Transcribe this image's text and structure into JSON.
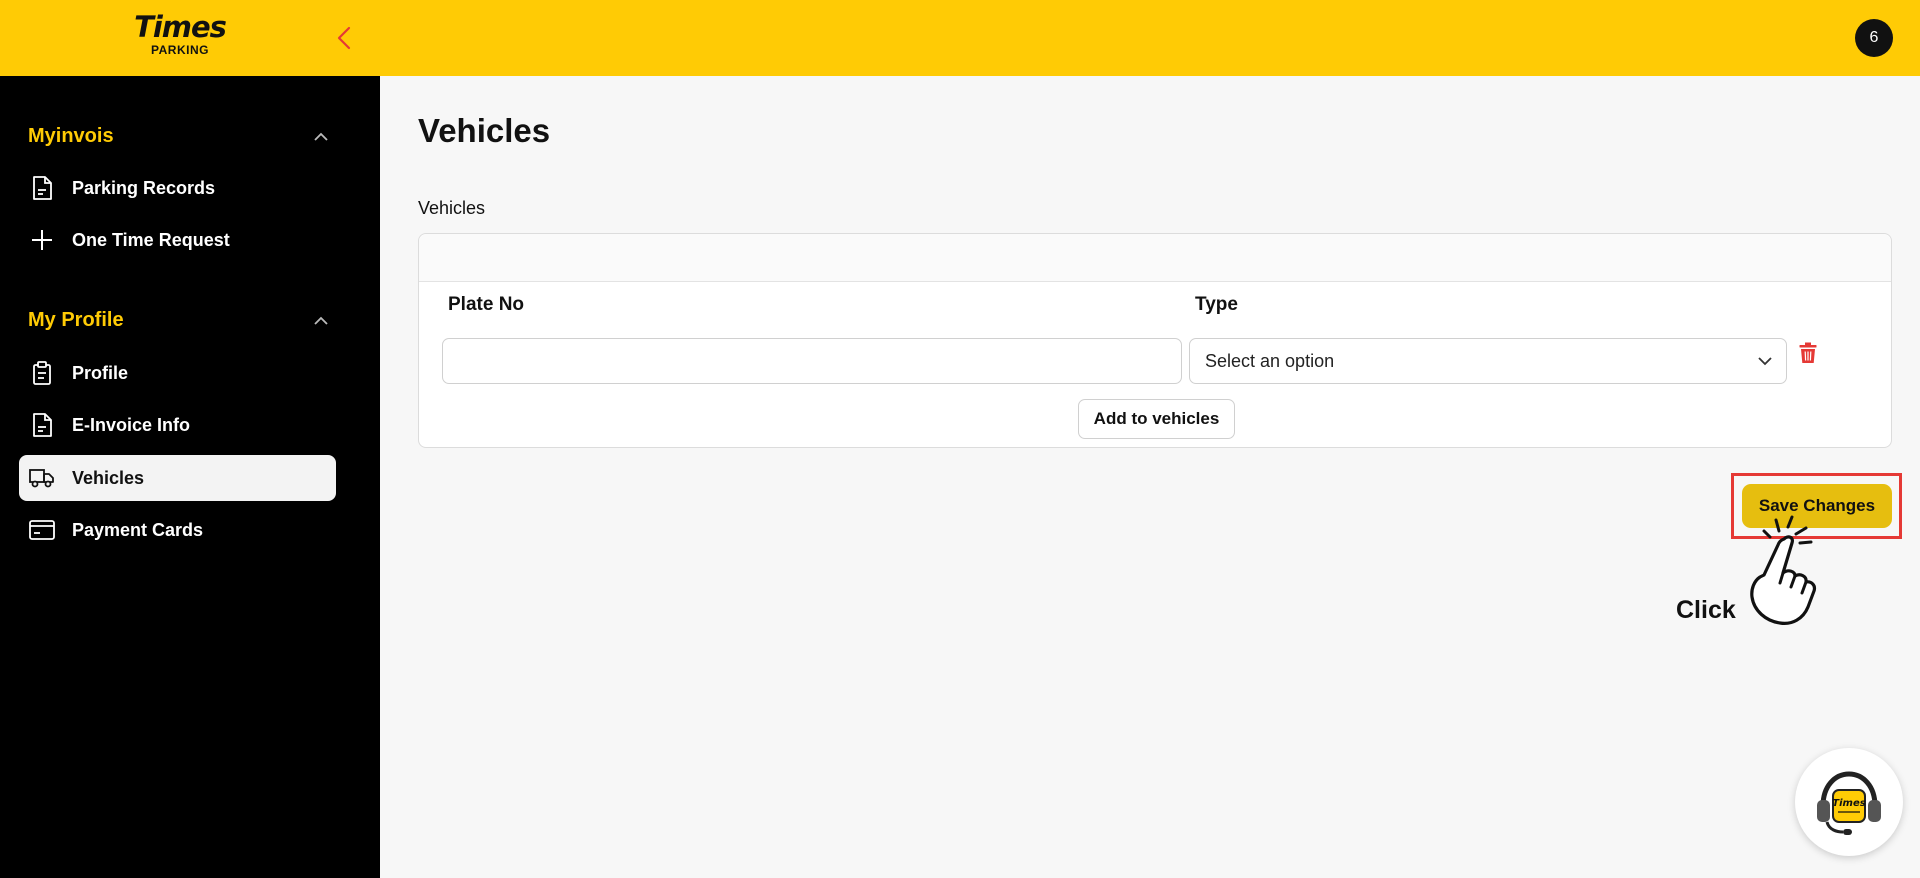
{
  "header": {
    "logo_main": "Times",
    "logo_sub": "PARKING",
    "avatar_text": "6",
    "accent_color": "#ffcb05"
  },
  "sidebar": {
    "sections": [
      {
        "title": "Myinvois",
        "items": [
          {
            "label": "Parking Records",
            "icon": "document-icon"
          },
          {
            "label": "One Time Request",
            "icon": "plus-icon"
          }
        ]
      },
      {
        "title": "My Profile",
        "items": [
          {
            "label": "Profile",
            "icon": "clipboard-icon"
          },
          {
            "label": "E-Invoice Info",
            "icon": "document-icon"
          },
          {
            "label": "Vehicles",
            "icon": "truck-icon",
            "active": true
          },
          {
            "label": "Payment Cards",
            "icon": "credit-card-icon"
          }
        ]
      }
    ]
  },
  "main": {
    "page_title": "Vehicles",
    "section_label": "Vehicles",
    "columns": {
      "plate": "Plate No",
      "type": "Type"
    },
    "plate_value": "",
    "type_value": "Select an option",
    "add_button": "Add to vehicles",
    "save_button": "Save Changes",
    "annotation": "Click"
  }
}
